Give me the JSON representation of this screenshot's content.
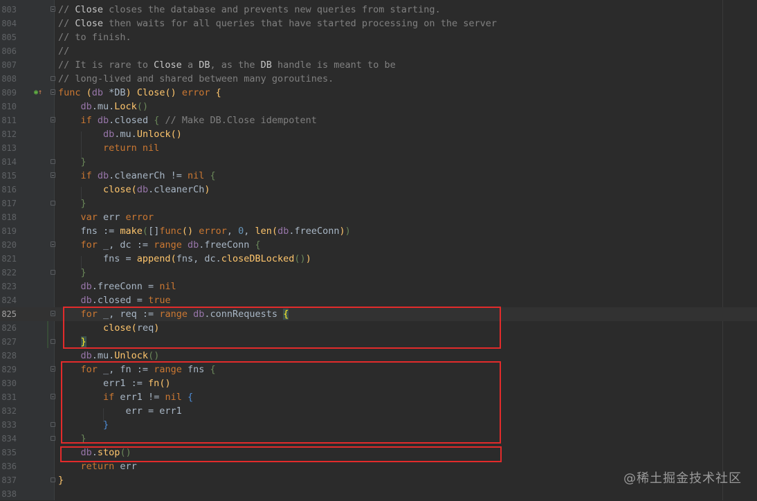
{
  "editor": {
    "lines": [
      {
        "n": "803",
        "fold": "open",
        "t": [
          [
            "cm",
            "// "
          ],
          [
            "cmb",
            "Close"
          ],
          [
            "cm",
            " closes the database and prevents new queries from starting."
          ]
        ]
      },
      {
        "n": "804",
        "t": [
          [
            "cm",
            "// "
          ],
          [
            "cmb",
            "Close"
          ],
          [
            "cm",
            " then waits for all queries that have started processing on the server"
          ]
        ]
      },
      {
        "n": "805",
        "t": [
          [
            "cm",
            "// to finish."
          ]
        ]
      },
      {
        "n": "806",
        "t": [
          [
            "cm",
            "//"
          ]
        ]
      },
      {
        "n": "807",
        "t": [
          [
            "cm",
            "// It is rare to "
          ],
          [
            "cmb",
            "Close"
          ],
          [
            "cm",
            " a "
          ],
          [
            "cmb",
            "DB"
          ],
          [
            "cm",
            ", as the "
          ],
          [
            "cmb",
            "DB"
          ],
          [
            "cm",
            " handle is meant to be"
          ]
        ]
      },
      {
        "n": "808",
        "fold": "close",
        "t": [
          [
            "cm",
            "// long-lived and shared between many goroutines."
          ]
        ]
      },
      {
        "n": "809",
        "fold": "open",
        "mark": true,
        "t": [
          [
            "kw",
            "func "
          ],
          [
            "p1",
            "("
          ],
          [
            "id",
            "db "
          ],
          [
            "v",
            "*DB"
          ],
          [
            "p1",
            ") "
          ],
          [
            "fn",
            "Close"
          ],
          [
            "p1",
            "() "
          ],
          [
            "tp",
            "error "
          ],
          [
            "p1",
            "{"
          ]
        ]
      },
      {
        "n": "810",
        "t": [
          [
            "v",
            "    "
          ],
          [
            "id",
            "db"
          ],
          [
            "v",
            ".mu."
          ],
          [
            "fn",
            "Lock"
          ],
          [
            "p2",
            "()"
          ]
        ]
      },
      {
        "n": "811",
        "fold": "open",
        "t": [
          [
            "v",
            "    "
          ],
          [
            "kw",
            "if "
          ],
          [
            "id",
            "db"
          ],
          [
            "v",
            ".closed "
          ],
          [
            "p2",
            "{ "
          ],
          [
            "cm",
            "// Make DB.Close idempotent"
          ]
        ]
      },
      {
        "n": "812",
        "t": [
          [
            "v",
            "        "
          ],
          [
            "id",
            "db"
          ],
          [
            "v",
            ".mu."
          ],
          [
            "fn",
            "Unlock"
          ],
          [
            "p1",
            "()"
          ]
        ]
      },
      {
        "n": "813",
        "t": [
          [
            "v",
            "        "
          ],
          [
            "kw",
            "return nil"
          ]
        ]
      },
      {
        "n": "814",
        "fold": "close",
        "t": [
          [
            "v",
            "    "
          ],
          [
            "p2",
            "}"
          ]
        ]
      },
      {
        "n": "815",
        "fold": "open",
        "t": [
          [
            "v",
            "    "
          ],
          [
            "kw",
            "if "
          ],
          [
            "id",
            "db"
          ],
          [
            "v",
            ".cleanerCh != "
          ],
          [
            "kw",
            "nil "
          ],
          [
            "p2",
            "{"
          ]
        ]
      },
      {
        "n": "816",
        "t": [
          [
            "v",
            "        "
          ],
          [
            "fn",
            "close"
          ],
          [
            "p1",
            "("
          ],
          [
            "id",
            "db"
          ],
          [
            "v",
            ".cleanerCh"
          ],
          [
            "p1",
            ")"
          ]
        ]
      },
      {
        "n": "817",
        "fold": "close",
        "t": [
          [
            "v",
            "    "
          ],
          [
            "p2",
            "}"
          ]
        ]
      },
      {
        "n": "818",
        "t": [
          [
            "v",
            "    "
          ],
          [
            "kw",
            "var "
          ],
          [
            "v",
            "err "
          ],
          [
            "tp",
            "error"
          ]
        ]
      },
      {
        "n": "819",
        "t": [
          [
            "v",
            "    fns := "
          ],
          [
            "fn",
            "make"
          ],
          [
            "p2",
            "("
          ],
          [
            "v",
            "[]"
          ],
          [
            "kw",
            "func"
          ],
          [
            "p1",
            "() "
          ],
          [
            "tp",
            "error"
          ],
          [
            "v",
            ", "
          ],
          [
            "num",
            "0"
          ],
          [
            "v",
            ", "
          ],
          [
            "fn",
            "len"
          ],
          [
            "p1",
            "("
          ],
          [
            "id",
            "db"
          ],
          [
            "v",
            ".freeConn"
          ],
          [
            "p1",
            ")"
          ],
          [
            "p2",
            ")"
          ]
        ]
      },
      {
        "n": "820",
        "fold": "open",
        "t": [
          [
            "v",
            "    "
          ],
          [
            "kw",
            "for "
          ],
          [
            "v",
            "_, dc := "
          ],
          [
            "kw",
            "range "
          ],
          [
            "id",
            "db"
          ],
          [
            "v",
            ".freeConn "
          ],
          [
            "p2",
            "{"
          ]
        ]
      },
      {
        "n": "821",
        "t": [
          [
            "v",
            "        fns = "
          ],
          [
            "fn",
            "append"
          ],
          [
            "p1",
            "("
          ],
          [
            "v",
            "fns, dc."
          ],
          [
            "fn",
            "closeDBLocked"
          ],
          [
            "p2",
            "()"
          ],
          [
            "p1",
            ")"
          ]
        ]
      },
      {
        "n": "822",
        "fold": "close",
        "t": [
          [
            "v",
            "    "
          ],
          [
            "p2",
            "}"
          ]
        ]
      },
      {
        "n": "823",
        "t": [
          [
            "v",
            "    "
          ],
          [
            "id",
            "db"
          ],
          [
            "v",
            ".freeConn = "
          ],
          [
            "kw",
            "nil"
          ]
        ]
      },
      {
        "n": "824",
        "t": [
          [
            "v",
            "    "
          ],
          [
            "id",
            "db"
          ],
          [
            "v",
            ".closed = "
          ],
          [
            "kw",
            "true"
          ]
        ]
      },
      {
        "n": "825",
        "fold": "open",
        "current": true,
        "t": [
          [
            "v",
            "    "
          ],
          [
            "kw",
            "for "
          ],
          [
            "v",
            "_, req := "
          ],
          [
            "kw",
            "range "
          ],
          [
            "id",
            "db"
          ],
          [
            "v",
            ".connRequests "
          ],
          [
            "bm",
            "{"
          ]
        ]
      },
      {
        "n": "826",
        "t": [
          [
            "v",
            "        "
          ],
          [
            "fn",
            "close"
          ],
          [
            "p1",
            "("
          ],
          [
            "v",
            "req"
          ],
          [
            "p1",
            ")"
          ]
        ]
      },
      {
        "n": "827",
        "fold": "close",
        "t": [
          [
            "v",
            "    "
          ],
          [
            "bm",
            "}"
          ]
        ]
      },
      {
        "n": "828",
        "t": [
          [
            "v",
            "    "
          ],
          [
            "id",
            "db"
          ],
          [
            "v",
            ".mu."
          ],
          [
            "fn",
            "Unlock"
          ],
          [
            "p2",
            "()"
          ]
        ]
      },
      {
        "n": "829",
        "fold": "open",
        "t": [
          [
            "v",
            "    "
          ],
          [
            "kw",
            "for "
          ],
          [
            "v",
            "_, fn := "
          ],
          [
            "kw",
            "range "
          ],
          [
            "v",
            "fns "
          ],
          [
            "p2",
            "{"
          ]
        ]
      },
      {
        "n": "830",
        "t": [
          [
            "v",
            "        err1 := "
          ],
          [
            "fn",
            "fn"
          ],
          [
            "p1",
            "()"
          ]
        ]
      },
      {
        "n": "831",
        "fold": "open",
        "t": [
          [
            "v",
            "        "
          ],
          [
            "kw",
            "if "
          ],
          [
            "v",
            "err1 != "
          ],
          [
            "kw",
            "nil "
          ],
          [
            "p3",
            "{"
          ]
        ]
      },
      {
        "n": "832",
        "t": [
          [
            "v",
            "            err = err1"
          ]
        ]
      },
      {
        "n": "833",
        "fold": "close",
        "t": [
          [
            "v",
            "        "
          ],
          [
            "p3",
            "}"
          ]
        ]
      },
      {
        "n": "834",
        "fold": "close",
        "t": [
          [
            "v",
            "    "
          ],
          [
            "p2",
            "}"
          ]
        ]
      },
      {
        "n": "835",
        "t": [
          [
            "v",
            "    "
          ],
          [
            "id",
            "db"
          ],
          [
            "v",
            "."
          ],
          [
            "fn",
            "stop"
          ],
          [
            "p2",
            "()"
          ]
        ]
      },
      {
        "n": "836",
        "t": [
          [
            "v",
            "    "
          ],
          [
            "kw",
            "return "
          ],
          [
            "v",
            "err"
          ]
        ]
      },
      {
        "n": "837",
        "fold": "close",
        "t": [
          [
            "p1",
            "}"
          ]
        ]
      },
      {
        "n": "838",
        "t": []
      }
    ]
  },
  "watermark": "@稀土掘金技术社区",
  "colors": {
    "background": "#2b2b2b",
    "gutter": "#313335",
    "highlight_box": "#e32b2b",
    "keyword": "#cc7832",
    "function": "#ffc66d",
    "receiver": "#9876aa",
    "comment": "#808080"
  },
  "icons": {
    "gutter_marker": "implements-method-icon"
  }
}
